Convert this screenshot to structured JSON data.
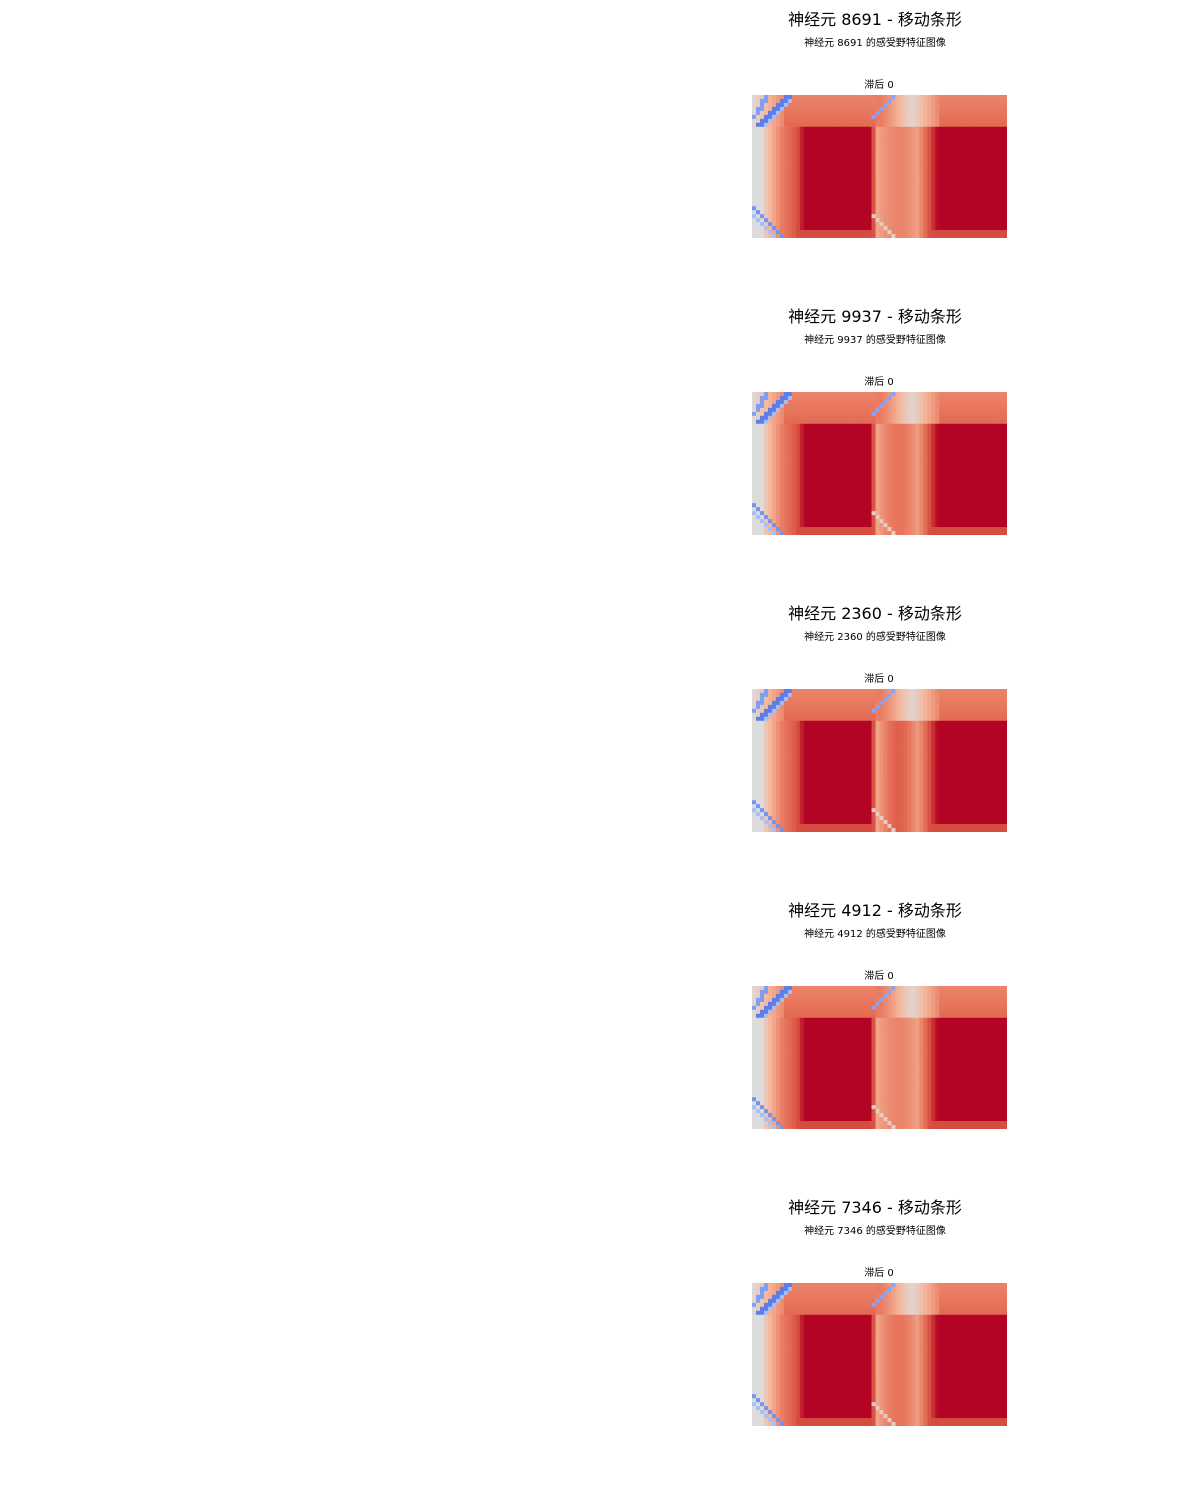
{
  "panels": [
    {
      "title": "神经元 8691 - 移动条形",
      "subtitle": "神经元 8691 的感受野特征图像",
      "lag_label": "滞后 0"
    },
    {
      "title": "神经元 9937 - 移动条形",
      "subtitle": "神经元 9937 的感受野特征图像",
      "lag_label": "滞后 0"
    },
    {
      "title": "神经元 2360 - 移动条形",
      "subtitle": "神经元 2360 的感受野特征图像",
      "lag_label": "滞后 0"
    },
    {
      "title": "神经元 4912 - 移动条形",
      "subtitle": "神经元 4912 的感受野特征图像",
      "lag_label": "滞后 0"
    },
    {
      "title": "神经元 7346 - 移动条形",
      "subtitle": "神经元 7346 的感受野特征图像",
      "lag_label": "滞后 0"
    }
  ],
  "chart_data": {
    "type": "heatmap",
    "colormap": "coolwarm",
    "colors": {
      "strong_positive": "#b40426",
      "positive": "#e7745b",
      "neutral": "#dddcdc",
      "negative": "#4b6bd6"
    },
    "grid": false,
    "axes_visible": false
  }
}
